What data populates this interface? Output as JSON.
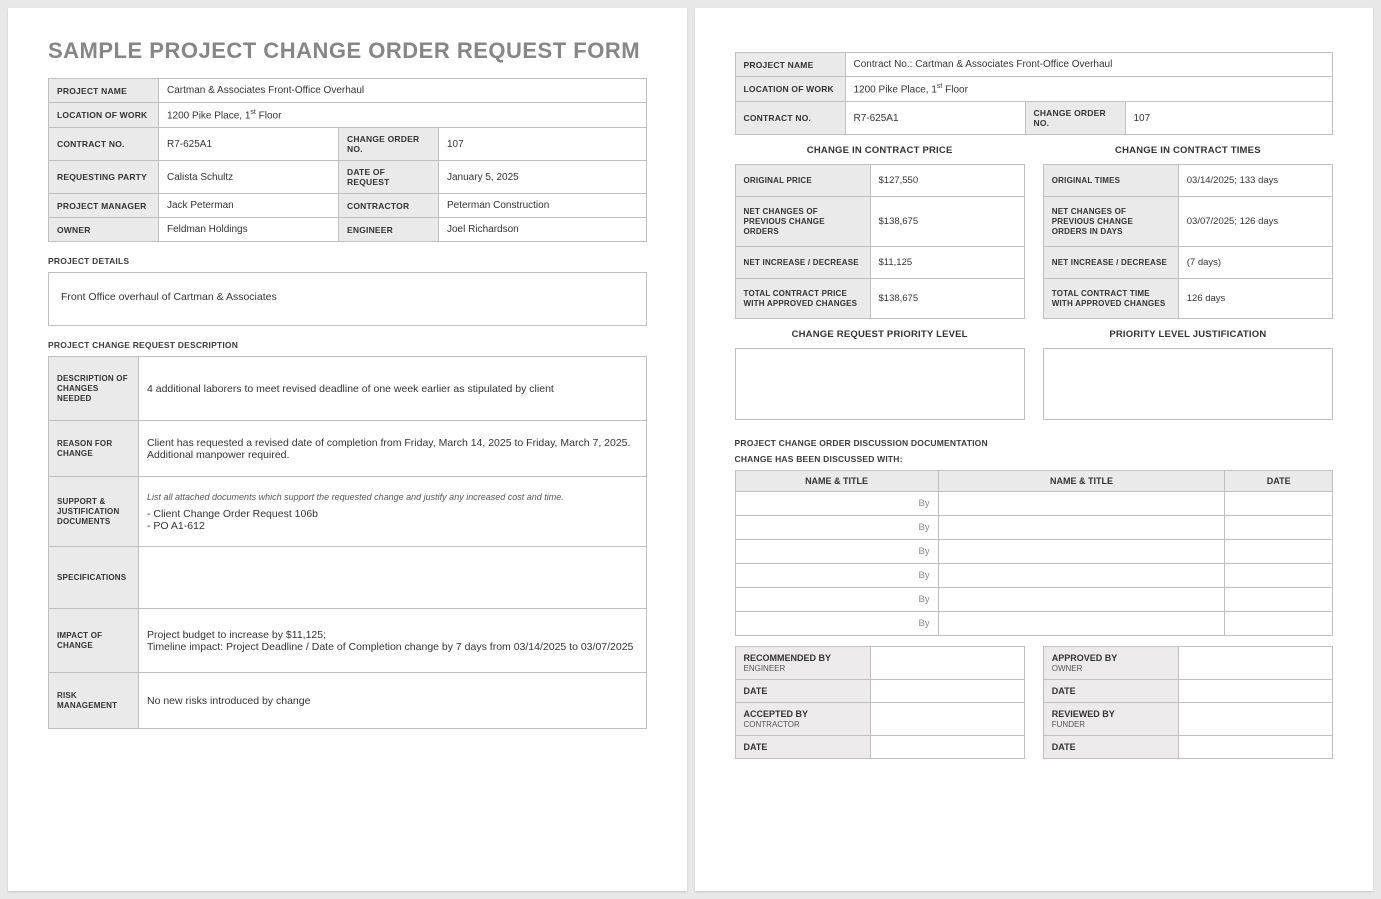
{
  "title": "SAMPLE PROJECT CHANGE ORDER REQUEST FORM",
  "header": {
    "project_name_label": "PROJECT NAME",
    "project_name": "Cartman & Associates Front-Office Overhaul",
    "location_label": "LOCATION OF WORK",
    "location": "1200 Pike Place, 1",
    "location_suffix": " Floor",
    "location_ord": "st",
    "contract_no_label": "CONTRACT NO.",
    "contract_no": "R7-625A1",
    "change_order_no_label": "CHANGE ORDER NO.",
    "change_order_no": "107",
    "requesting_party_label": "REQUESTING PARTY",
    "requesting_party": "Calista Schultz",
    "date_request_label": "DATE OF REQUEST",
    "date_request": "January 5, 2025",
    "project_manager_label": "PROJECT MANAGER",
    "project_manager": "Jack Peterman",
    "contractor_label": "CONTRACTOR",
    "contractor": "Peterman Construction",
    "owner_label": "OWNER",
    "owner": "Feldman Holdings",
    "engineer_label": "ENGINEER",
    "engineer": "Joel Richardson"
  },
  "sections": {
    "project_details_label": "PROJECT DETAILS",
    "project_details": "Front Office overhaul of Cartman & Associates",
    "change_desc_label": "PROJECT CHANGE REQUEST DESCRIPTION"
  },
  "changes": {
    "desc_label": "DESCRIPTION OF CHANGES NEEDED",
    "desc": "4 additional laborers to meet revised deadline of one week earlier as stipulated by client",
    "reason_label": "REASON FOR CHANGE",
    "reason": "Client has requested a revised date of completion from Friday, March 14, 2025 to Friday, March 7, 2025.  Additional manpower required.",
    "support_label": "SUPPORT & JUSTIFICATION DOCUMENTS",
    "support_note": "List all attached documents which support the requested change and justify any increased cost and time.",
    "support1": "- Client Change Order Request 106b",
    "support2": "- PO A1-612",
    "spec_label": "SPECIFICATIONS",
    "spec": "",
    "impact_label": "IMPACT OF CHANGE",
    "impact": "Project budget to increase by $11,125;\nTimeline impact: Project Deadline / Date of Completion change by 7 days from 03/14/2025 to 03/07/2025",
    "risk_label": "RISK MANAGEMENT",
    "risk": "No new risks introduced by change"
  },
  "page2": {
    "project_name": "Contract No.: Cartman & Associates Front-Office Overhaul",
    "location": "1200 Pike Place, 1",
    "location_ord": "st",
    "location_suffix": " Floor",
    "contract_no": "R7-625A1",
    "change_order_no": "107"
  },
  "price": {
    "heading": "CHANGE IN CONTRACT PRICE",
    "orig_label": "ORIGINAL PRICE",
    "orig": "$127,550",
    "net_prev_label": "NET CHANGES OF PREVIOUS CHANGE ORDERS",
    "net_prev": "$138,675",
    "net_inc_label": "NET INCREASE / DECREASE",
    "net_inc": "$11,125",
    "total_label": "TOTAL CONTRACT PRICE WITH APPROVED CHANGES",
    "total": "$138,675"
  },
  "times": {
    "heading": "CHANGE IN CONTRACT TIMES",
    "orig_label": "ORIGINAL TIMES",
    "orig": "03/14/2025; 133 days",
    "net_prev_label": "NET CHANGES OF PREVIOUS CHANGE ORDERS IN DAYS",
    "net_prev": "03/07/2025; 126 days",
    "net_inc_label": "NET INCREASE / DECREASE",
    "net_inc": "(7 days)",
    "total_label": "TOTAL CONTRACT TIME WITH APPROVED CHANGES",
    "total": "126 days"
  },
  "priority": {
    "level_label": "CHANGE REQUEST PRIORITY LEVEL",
    "just_label": "PRIORITY LEVEL JUSTIFICATION"
  },
  "discussion": {
    "heading1": "PROJECT CHANGE ORDER DISCUSSION DOCUMENTATION",
    "heading2": "CHANGE HAS BEEN DISCUSSED WITH:",
    "col_name": "NAME & TITLE",
    "col_date": "DATE",
    "by": "By"
  },
  "sign": {
    "rec_label": "RECOMMENDED BY",
    "rec_sub": "ENGINEER",
    "app_label": "APPROVED BY",
    "app_sub": "OWNER",
    "date_label": "DATE",
    "acc_label": "ACCEPTED BY",
    "acc_sub": "CONTRACTOR",
    "rev_label": "REVIEWED BY",
    "rev_sub": "FUNDER"
  }
}
